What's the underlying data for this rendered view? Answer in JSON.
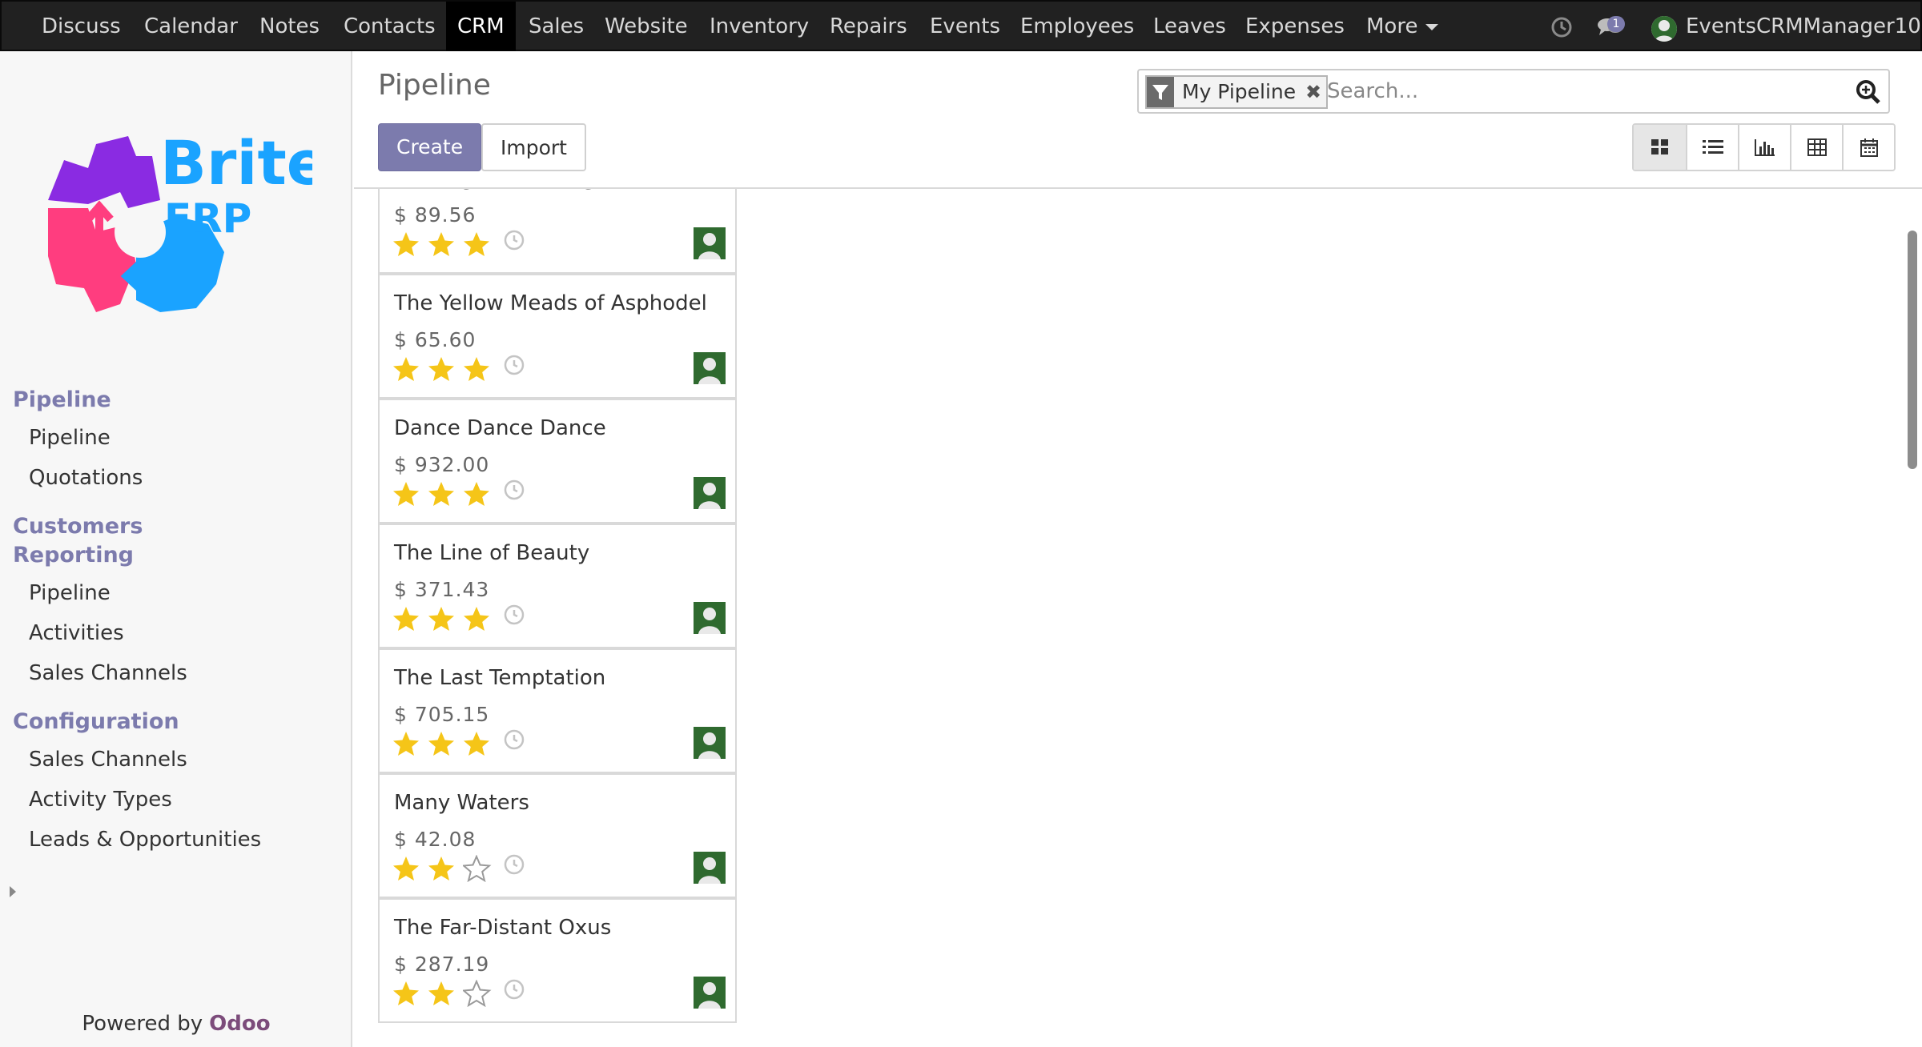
{
  "app_menu": {
    "items": [
      "Discuss",
      "Calendar",
      "Notes",
      "Contacts",
      "CRM",
      "Sales",
      "Website",
      "Inventory",
      "Repairs",
      "Events",
      "Employees",
      "Leaves",
      "Expenses"
    ],
    "active": "CRM",
    "more_label": "More",
    "message_count": "1",
    "user_name": "EventsCRMManager10"
  },
  "sidebar": {
    "logo_brite": "Brite",
    "logo_erp": "ERP",
    "sections": [
      {
        "heading": "Pipeline",
        "items": [
          "Pipeline",
          "Quotations"
        ]
      },
      {
        "heading": "Customers",
        "items": []
      },
      {
        "heading": "Reporting",
        "items": [
          "Pipeline",
          "Activities",
          "Sales Channels"
        ]
      },
      {
        "heading": "Configuration",
        "items": [
          "Sales Channels",
          "Activity Types",
          "Leads & Opportunities"
        ]
      }
    ],
    "powered_by": "Powered by",
    "powered_brand": "Odoo"
  },
  "control_panel": {
    "breadcrumb": "Pipeline",
    "create_label": "Create",
    "import_label": "Import",
    "search": {
      "facet_label": "My Pipeline",
      "placeholder": "Search..."
    },
    "views": [
      "kanban",
      "list",
      "graph",
      "pivot",
      "calendar"
    ],
    "active_view": "kanban"
  },
  "kanban": {
    "cards": [
      {
        "name": "Cabbages and Kings",
        "amount": "$ 89.56",
        "stars": 3
      },
      {
        "name": "The Yellow Meads of Asphodel",
        "amount": "$ 65.60",
        "stars": 3
      },
      {
        "name": "Dance Dance Dance",
        "amount": "$ 932.00",
        "stars": 3
      },
      {
        "name": "The Line of Beauty",
        "amount": "$ 371.43",
        "stars": 3
      },
      {
        "name": "The Last Temptation",
        "amount": "$ 705.15",
        "stars": 3
      },
      {
        "name": "Many Waters",
        "amount": "$ 42.08",
        "stars": 2
      },
      {
        "name": "The Far-Distant Oxus",
        "amount": "$ 287.19",
        "stars": 2
      }
    ]
  },
  "colors": {
    "brand": "#7c7bad",
    "topbar": "#212121",
    "star": "#f5c518",
    "avatar": "#2f6a2f"
  },
  "icons": {
    "activity": "clock-icon",
    "messages": "chat-bubbles-icon",
    "filter": "funnel-icon",
    "search": "magnifier-icon"
  }
}
